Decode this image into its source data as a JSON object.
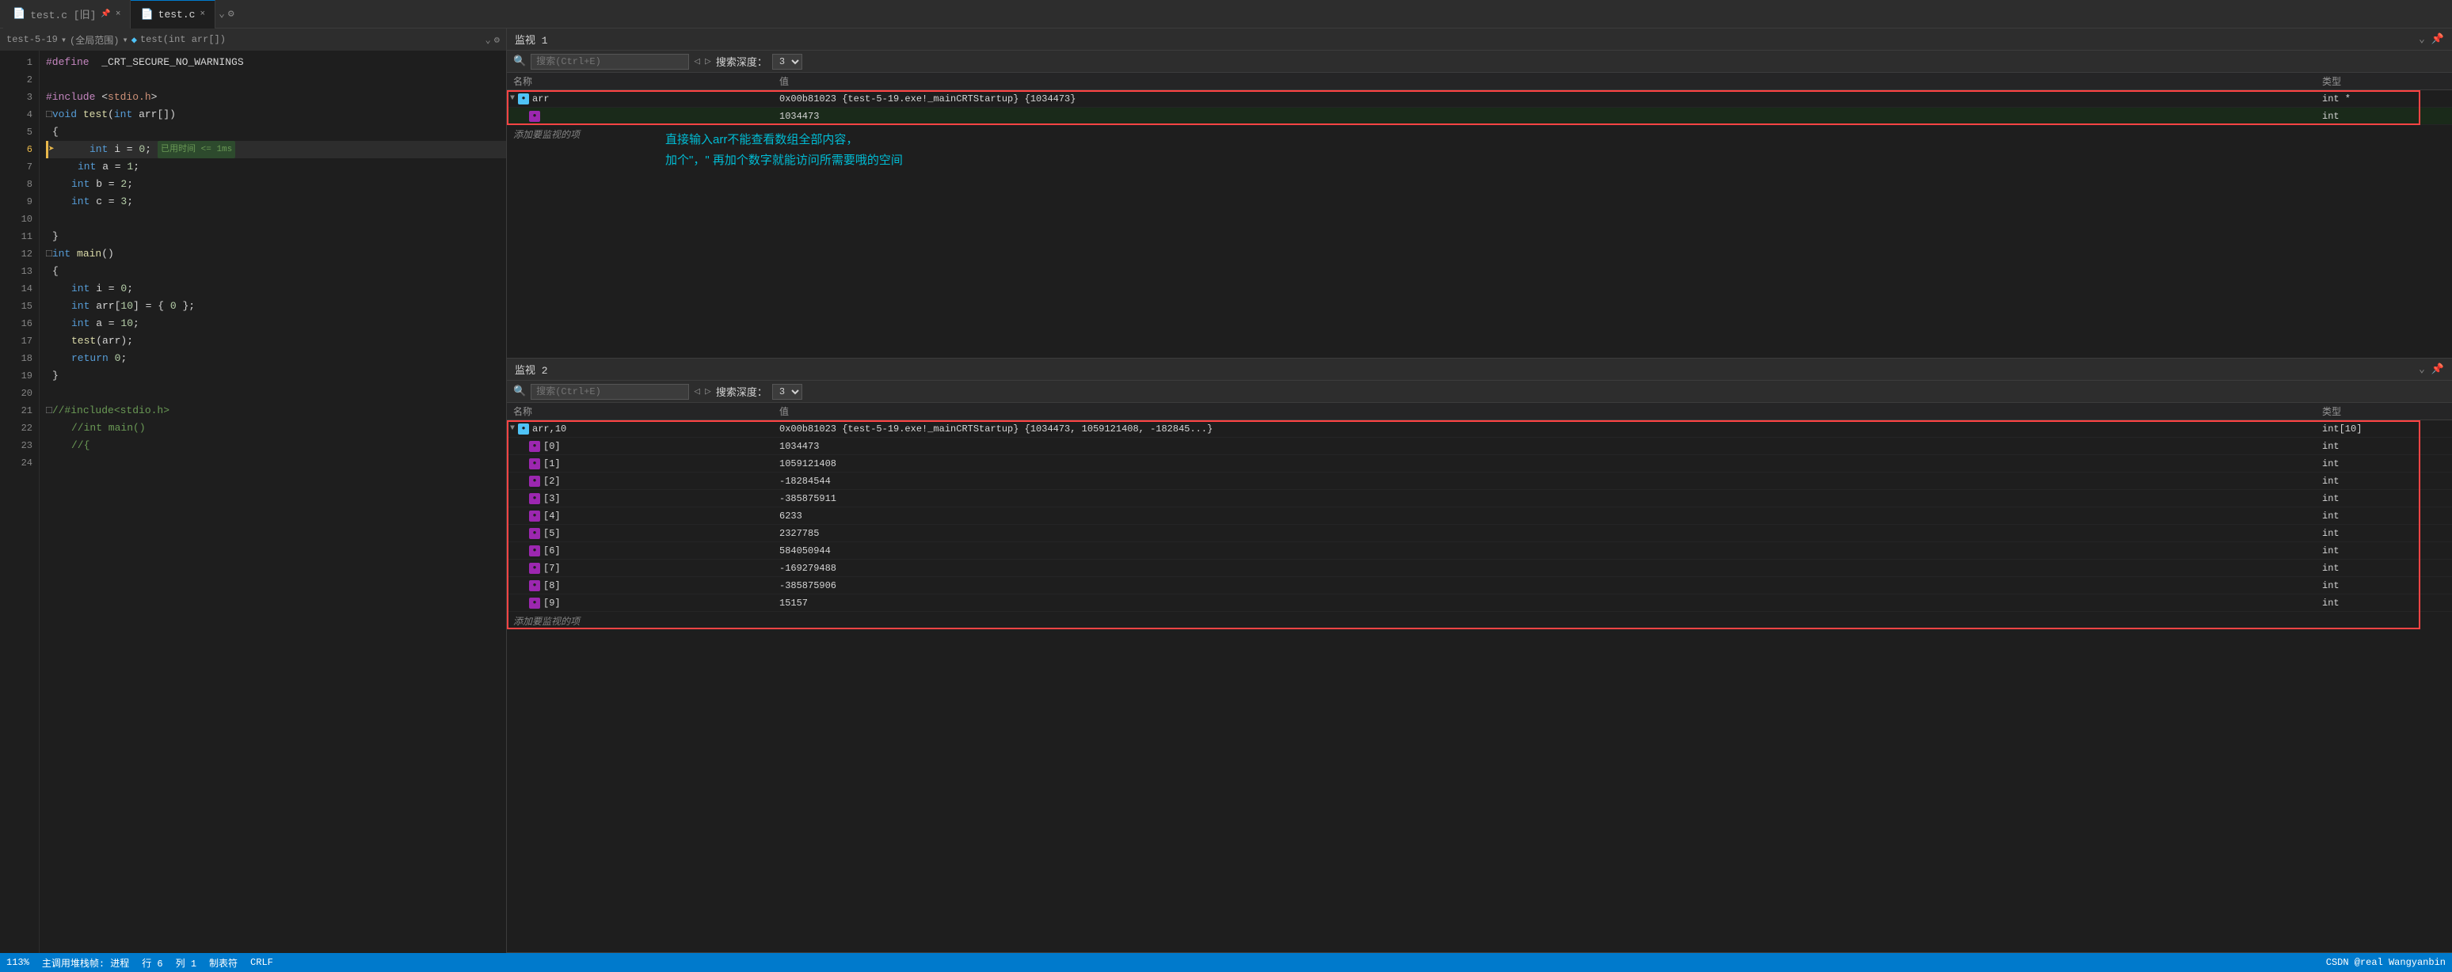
{
  "tabs": [
    {
      "id": "test-c-old",
      "label": "test.c [旧]",
      "icon": "📄",
      "active": false,
      "closable": true
    },
    {
      "id": "test-c",
      "label": "test.c",
      "icon": "📄",
      "active": true,
      "closable": true
    }
  ],
  "breadcrumb": {
    "config": "test-5-19",
    "scope": "(全局范围)",
    "func": "test(int arr[])"
  },
  "code": {
    "lines": [
      {
        "num": 1,
        "text": "#define  _CRT_SECURE_NO_WARNINGS",
        "type": "pp"
      },
      {
        "num": 2,
        "text": "",
        "type": "plain"
      },
      {
        "num": 3,
        "text": "#include <stdio.h>",
        "type": "pp"
      },
      {
        "num": 4,
        "text": "□void test(int arr[])",
        "type": "func"
      },
      {
        "num": 5,
        "text": "{",
        "type": "plain"
      },
      {
        "num": 6,
        "text": "    int i = 0;  已用时间 <= 1ms",
        "type": "current"
      },
      {
        "num": 7,
        "text": "    int a = 1;",
        "type": "plain"
      },
      {
        "num": 8,
        "text": "    int b = 2;",
        "type": "plain"
      },
      {
        "num": 9,
        "text": "    int c = 3;",
        "type": "plain"
      },
      {
        "num": 10,
        "text": "",
        "type": "plain"
      },
      {
        "num": 11,
        "text": "}",
        "type": "plain"
      },
      {
        "num": 12,
        "text": "□int main()",
        "type": "func"
      },
      {
        "num": 13,
        "text": "{",
        "type": "plain"
      },
      {
        "num": 14,
        "text": "    int i = 0;",
        "type": "plain"
      },
      {
        "num": 15,
        "text": "    int arr[10] = { 0 };",
        "type": "plain"
      },
      {
        "num": 16,
        "text": "    int a = 10;",
        "type": "plain"
      },
      {
        "num": 17,
        "text": "    test(arr);",
        "type": "plain"
      },
      {
        "num": 18,
        "text": "    return 0;",
        "type": "plain"
      },
      {
        "num": 19,
        "text": "}",
        "type": "plain"
      },
      {
        "num": 20,
        "text": "",
        "type": "plain"
      },
      {
        "num": 21,
        "text": "□//#include<stdio.h>",
        "type": "comment"
      },
      {
        "num": 22,
        "text": "    //int main()",
        "type": "comment"
      },
      {
        "num": 23,
        "text": "    //{",
        "type": "comment"
      },
      {
        "num": 24,
        "text": "",
        "type": "plain"
      }
    ]
  },
  "watch1": {
    "title": "监视 1",
    "search_placeholder": "搜索(Ctrl+E)",
    "search_depth_label": "搜索深度：",
    "search_depth_value": "3",
    "columns": [
      "名称",
      "值",
      "类型"
    ],
    "rows": [
      {
        "indent": 0,
        "expanded": true,
        "name": "arr",
        "value": "0x00b81023 {test-5-19.exe!_mainCRTStartup} {1034473}",
        "type": "int *"
      },
      {
        "indent": 1,
        "expanded": false,
        "name": "",
        "value": "1034473",
        "type": "int"
      }
    ],
    "add_label": "添加要监视的项",
    "annotation": {
      "text": "直接输入arr不能查看数组全部内容，\n加个\",\" 再加个数字就能访问所需要哦的空间",
      "color": "#00bcd4"
    }
  },
  "watch2": {
    "title": "监视 2",
    "search_placeholder": "搜索(Ctrl+E)",
    "search_depth_label": "搜索深度：",
    "search_depth_value": "3",
    "columns": [
      "名称",
      "值",
      "类型"
    ],
    "rows": [
      {
        "indent": 0,
        "expanded": true,
        "name": "arr,10",
        "value": "0x00b81023 {test-5-19.exe!_mainCRTStartup} {1034473, 1059121408, -182845...}",
        "type": "int[10]"
      },
      {
        "indent": 1,
        "name": "[0]",
        "value": "1034473",
        "type": "int"
      },
      {
        "indent": 1,
        "name": "[1]",
        "value": "1059121408",
        "type": "int"
      },
      {
        "indent": 1,
        "name": "[2]",
        "value": "-18284544",
        "type": "int"
      },
      {
        "indent": 1,
        "name": "[3]",
        "value": "-385875911",
        "type": "int"
      },
      {
        "indent": 1,
        "name": "[4]",
        "value": "6233",
        "type": "int"
      },
      {
        "indent": 1,
        "name": "[5]",
        "value": "2327785",
        "type": "int"
      },
      {
        "indent": 1,
        "name": "[6]",
        "value": "584050944",
        "type": "int"
      },
      {
        "indent": 1,
        "name": "[7]",
        "value": "-169279488",
        "type": "int"
      },
      {
        "indent": 1,
        "name": "[8]",
        "value": "-385875906",
        "type": "int"
      },
      {
        "indent": 1,
        "name": "[9]",
        "value": "15157",
        "type": "int"
      }
    ],
    "add_label": "添加要监视的项"
  },
  "status": {
    "left": [
      "主调用堆栈帧: 进程",
      "行 6",
      "列 1",
      "制表符",
      "CRLF"
    ],
    "right": [
      "CSDN @real Wangyanbin"
    ]
  },
  "zoom": "113%"
}
